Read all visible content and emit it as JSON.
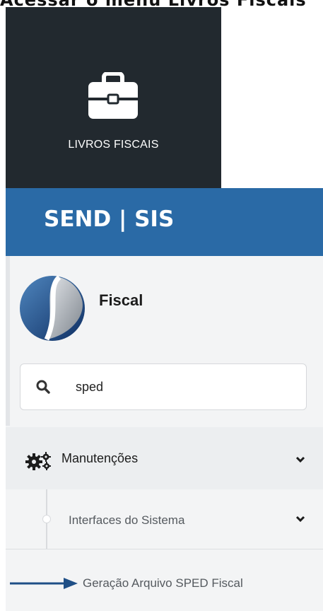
{
  "partial_top_text": "Acessar o menu Livros Fiscais",
  "tile": {
    "label": "LIVROS FISCAIS",
    "icon": "briefcase-icon"
  },
  "header": {
    "brand": "SEND | SIS"
  },
  "sidebar": {
    "module_name": "Fiscal",
    "logo": "fiscal-logo",
    "search": {
      "value": "sped",
      "icon": "search-icon"
    },
    "menu": {
      "main": {
        "label": "Manutenções",
        "icon": "gears-icon"
      },
      "sub": {
        "label": "Interfaces do Sistema"
      },
      "leaf": {
        "label": "Geração Arquivo SPED Fiscal"
      }
    }
  },
  "colors": {
    "tile_bg": "#22292f",
    "header_bg": "#2a6aa6",
    "arrow": "#1f4f86"
  }
}
